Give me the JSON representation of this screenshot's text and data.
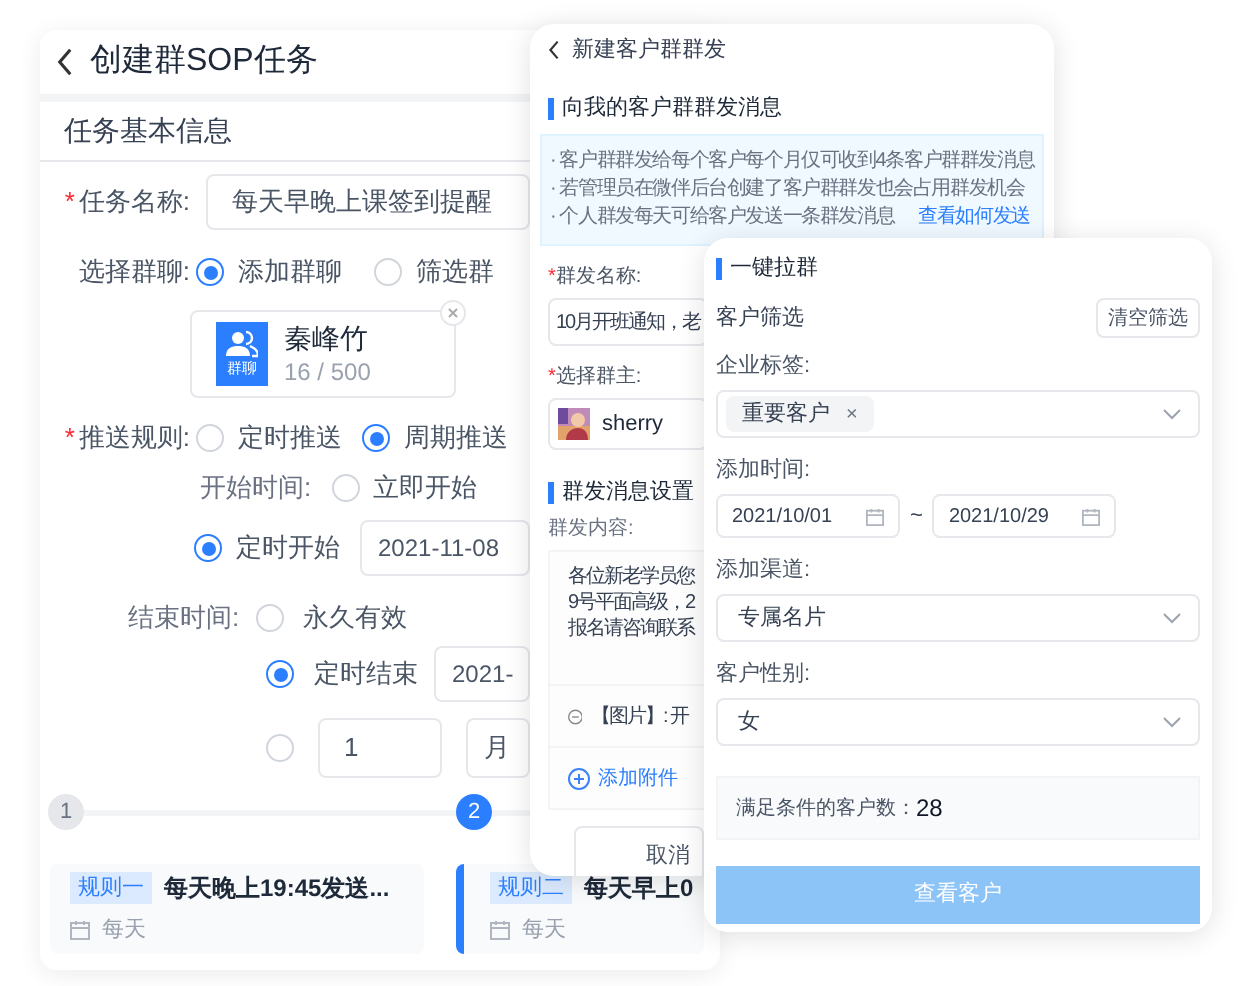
{
  "task_form": {
    "title": "创建群SOP任务",
    "section": "任务基本信息",
    "task_name": {
      "mark": "*",
      "label": "任务名称:",
      "value": "每天早晚上课签到提醒"
    },
    "group_chat": {
      "label": "选择群聊:",
      "options": [
        {
          "label": "添加群聊",
          "selected": true
        },
        {
          "label": "筛选群",
          "selected": false
        }
      ]
    },
    "chat": {
      "icon_label": "群聊",
      "name": "秦峰竹",
      "count": "16 / 500"
    },
    "push_rule": {
      "mark": "*",
      "label": "推送规则:",
      "options": [
        {
          "label": "定时推送",
          "selected": false
        },
        {
          "label": "周期推送",
          "selected": true
        }
      ]
    },
    "start_time": {
      "label": "开始时间:",
      "options": [
        {
          "label": "立即开始",
          "selected": false
        },
        {
          "label": "定时开始",
          "selected": true,
          "value": "2021-11-08"
        }
      ]
    },
    "end_time": {
      "label": "结束时间:",
      "options": [
        {
          "label": "永久有效",
          "selected": false
        },
        {
          "label": "定时结束",
          "selected": true,
          "value": "2021-"
        },
        {
          "selected": false,
          "number": "1",
          "unit": "月"
        }
      ]
    },
    "steps": [
      {
        "number": "1",
        "selected": false
      },
      {
        "number": "2",
        "selected": true
      }
    ],
    "rules": [
      {
        "tag": "规则一",
        "text": "每天晚上19:45发送...",
        "frequency": "每天",
        "selected": false
      },
      {
        "tag": "规则二",
        "text": "每天早上0",
        "frequency": "每天",
        "selected": true
      }
    ]
  },
  "group_broadcast": {
    "title": "新建客户群群发",
    "section": "向我的客户群群发消息",
    "notes": [
      "· 客户群群发给每个客户每个月仅可收到4条客户群群发消息",
      "· 若管理员在微伴后台创建了客户群群发也会占用群发机会",
      "· 个人群发每天可给客户发送一条群发消息"
    ],
    "help_link": "查看如何发送",
    "name_field": {
      "mark": "*",
      "label": "群发名称:",
      "value": "10月开班通知，老"
    },
    "owner_field": {
      "mark": "*",
      "label": "选择群主:",
      "value": "sherry"
    },
    "settings_section": "群发消息设置",
    "content_label": "群发内容:",
    "content_lines": [
      "各位新老学员您",
      "9号平面高级，2",
      "报名请咨询联系"
    ],
    "attachment": "【图片】: 开",
    "add_attachment": "添加附件",
    "cancel_button": "取消"
  },
  "pull_group": {
    "title": "一键拉群",
    "filter_label": "客户筛选",
    "clear_button": "清空筛选",
    "tag_label": "企业标签:",
    "tags": [
      {
        "label": "重要客户",
        "remove": "×"
      }
    ],
    "time_label": "添加时间:",
    "date_from": "2021/10/01",
    "range_separator": "~",
    "date_to": "2021/10/29",
    "channel_label": "添加渠道:",
    "channel": "专属名片",
    "gender_label": "客户性别:",
    "gender": "女",
    "count_label": "满足条件的客户数：",
    "count": "28",
    "view_button": "查看客户"
  }
}
